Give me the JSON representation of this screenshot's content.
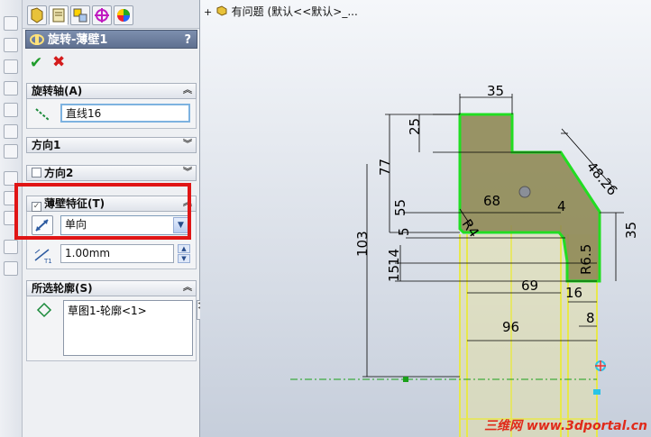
{
  "panel": {
    "title": "旋转-薄壁1",
    "help": "?",
    "ok": "✔",
    "cancel": "✖",
    "axis_section": {
      "label": "旋转轴(A)",
      "value": "直线16"
    },
    "direction1": {
      "label": "方向1"
    },
    "direction2": {
      "label": "方向2"
    },
    "thin_feature": {
      "label": "薄壁特征(T)",
      "type_value": "单向",
      "thickness": "1.00mm"
    },
    "contours": {
      "label": "所选轮廓(S)",
      "item": "草图1-轮廓<1>"
    }
  },
  "tree": {
    "item": "有问题 (默认<<默认>_..."
  },
  "watermark": "三维网 www.3dportal.cn",
  "dimensions": [
    "35",
    "25",
    "77",
    "48.26",
    "68",
    "4",
    "35",
    "55",
    "5",
    "R4",
    "103",
    "14",
    "15",
    "69",
    "R6.5",
    "16",
    "96",
    "8"
  ],
  "colors": {
    "profile": "#22dd22",
    "fill": "#8f8a55",
    "accent_red": "#e01515"
  }
}
